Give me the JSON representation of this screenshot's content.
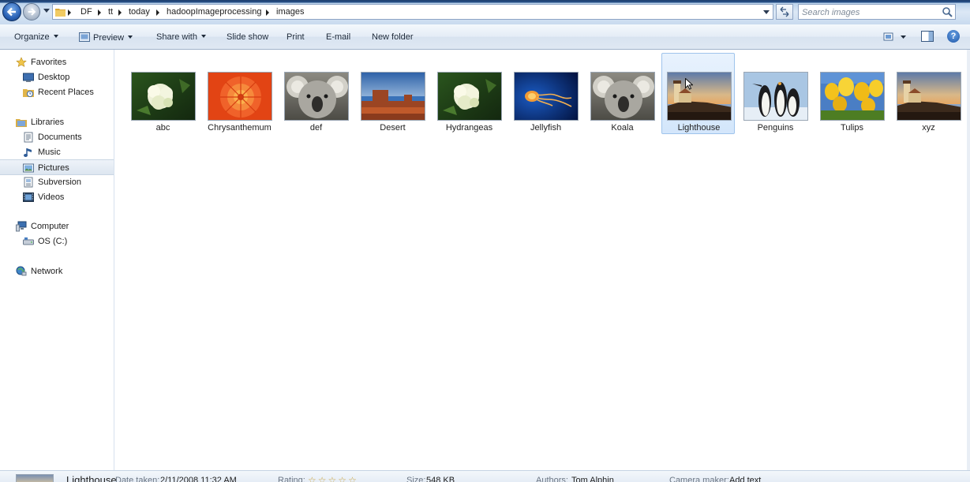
{
  "address_bar": {
    "breadcrumbs": [
      "DF",
      "tt",
      "today",
      "hadoopImageprocessing",
      "images"
    ]
  },
  "search": {
    "placeholder": "Search images"
  },
  "toolbar": {
    "organize": "Organize",
    "preview": "Preview",
    "share_with": "Share with",
    "slide_show": "Slide show",
    "print": "Print",
    "email": "E-mail",
    "new_folder": "New folder"
  },
  "sidebar": {
    "favorites": "Favorites",
    "desktop": "Desktop",
    "recent_places": "Recent Places",
    "libraries": "Libraries",
    "documents": "Documents",
    "music": "Music",
    "pictures": "Pictures",
    "subversion": "Subversion",
    "videos": "Videos",
    "computer": "Computer",
    "os_c": "OS (C:)",
    "network": "Network"
  },
  "files": [
    {
      "name": "abc",
      "thumb": "hydrangea"
    },
    {
      "name": "Chrysanthemum",
      "thumb": "chrysanthemum"
    },
    {
      "name": "def",
      "thumb": "koala"
    },
    {
      "name": "Desert",
      "thumb": "desert"
    },
    {
      "name": "Hydrangeas",
      "thumb": "hydrangea"
    },
    {
      "name": "Jellyfish",
      "thumb": "jellyfish"
    },
    {
      "name": "Koala",
      "thumb": "koala"
    },
    {
      "name": "Lighthouse",
      "thumb": "lighthouse",
      "selected": true
    },
    {
      "name": "Penguins",
      "thumb": "penguins"
    },
    {
      "name": "Tulips",
      "thumb": "tulips"
    },
    {
      "name": "xyz",
      "thumb": "lighthouse"
    }
  ],
  "details": {
    "name": "Lighthouse",
    "date_taken_label": "Date taken:",
    "date_taken": "2/11/2008 11:32 AM",
    "rating_label": "Rating:",
    "rating_stars": 0,
    "size_label": "Size:",
    "size": "548 KB",
    "authors_label": "Authors:",
    "authors": "Tom Alphin",
    "camera_maker_label": "Camera maker:",
    "camera_maker": "Add text"
  }
}
